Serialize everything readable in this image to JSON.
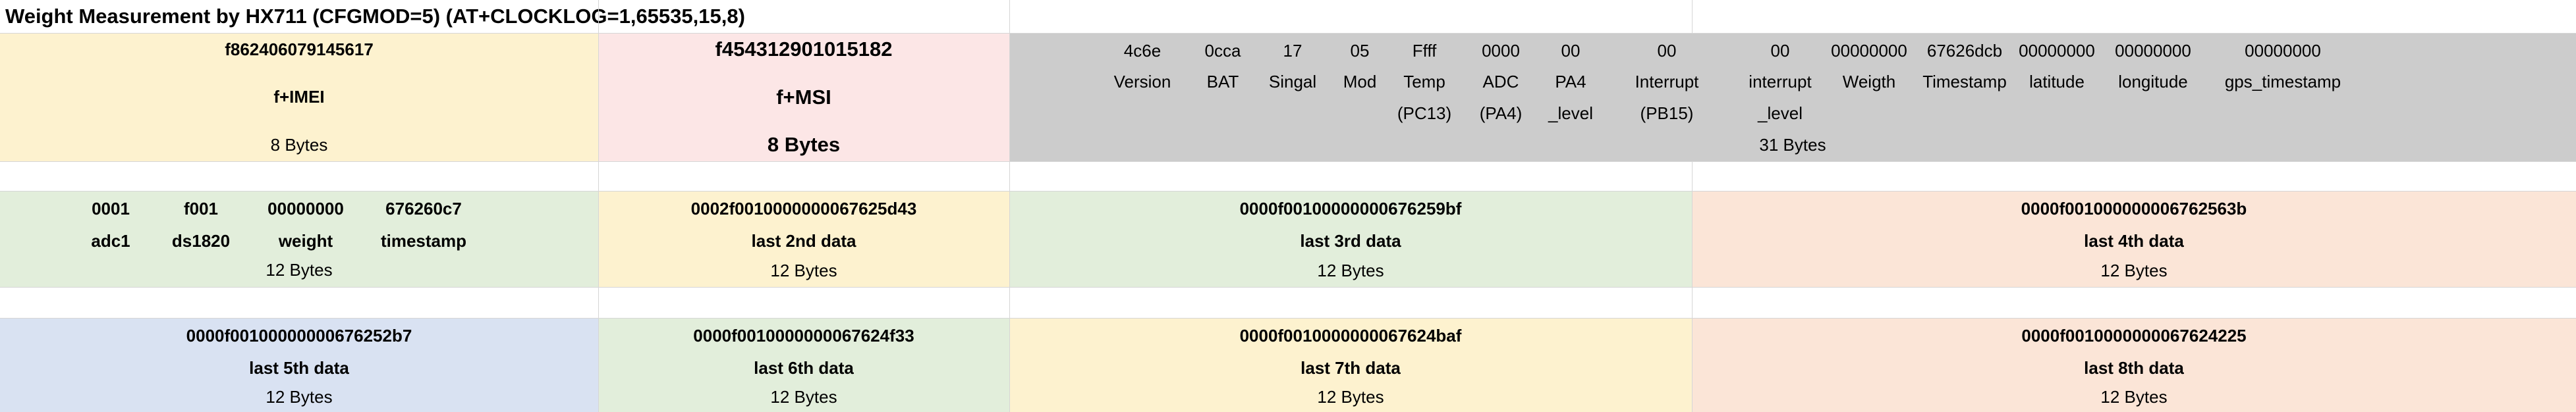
{
  "title": "Weight Measurement by HX711  (CFGMOD=5)  (AT+CLOCKLOG=1,65535,15,8)",
  "header": {
    "imei_value": "f862406079145617",
    "imei_label": "f+IMEI",
    "imei_size": "8 Bytes",
    "imsi_value": "f454312901015182",
    "imsi_label": "f+MSI",
    "imsi_size": "8 Bytes",
    "payload_size": "31 Bytes",
    "fields": [
      {
        "value": "4c6e",
        "label": "Version",
        "label2": ""
      },
      {
        "value": "0cca",
        "label": "BAT",
        "label2": ""
      },
      {
        "value": "17",
        "label": "Singal",
        "label2": ""
      },
      {
        "value": "05",
        "label": "Mod",
        "label2": ""
      },
      {
        "value": "Ffff",
        "label": "Temp",
        "label2": "(PC13)"
      },
      {
        "value": "0000",
        "label": "ADC",
        "label2": "(PA4)"
      },
      {
        "value": "00",
        "label": "PA4",
        "label2": "_level"
      },
      {
        "value": "00",
        "label": "Interrupt",
        "label2": "(PB15)"
      },
      {
        "value": "00",
        "label": "interrupt",
        "label2": "_level"
      },
      {
        "value": "00000000",
        "label": "Weigth",
        "label2": ""
      },
      {
        "value": "67626dcb",
        "label": "Timestamp",
        "label2": ""
      },
      {
        "value": "00000000",
        "label": "latitude",
        "label2": ""
      },
      {
        "value": "00000000",
        "label": "longitude",
        "label2": ""
      },
      {
        "value": "00000000",
        "label": "gps_timestamp",
        "label2": ""
      }
    ]
  },
  "row2": {
    "first": {
      "values": [
        "0001",
        "f001",
        "00000000",
        "676260c7"
      ],
      "labels": [
        "adc1",
        "ds1820",
        "weight",
        "timestamp"
      ],
      "size": "12 Bytes"
    },
    "blocks": [
      {
        "value": "0002f0010000000067625d43",
        "label": "last 2nd data",
        "size": "12 Bytes"
      },
      {
        "value": "0000f00100000000676259bf",
        "label": "last 3rd data",
        "size": "12 Bytes"
      },
      {
        "value": "0000f0010000000067625 63b",
        "label": "last 4th data",
        "size": "12 Bytes"
      }
    ]
  },
  "row3": {
    "blocks": [
      {
        "value": "0000f00100000000676252b7",
        "label": "last 5th data",
        "size": "12 Bytes"
      },
      {
        "value": "0000f0010000000067624f33",
        "label": "last 6th data",
        "size": "12 Bytes"
      },
      {
        "value": "0000f0010000000067624baf",
        "label": "last 7th data",
        "size": "12 Bytes"
      },
      {
        "value": "0000f00100000000676242 25",
        "label": "last 8th data",
        "size": "12 Bytes"
      }
    ]
  },
  "colors": {
    "yellow": "#fdf2cf",
    "pink": "#fce6e6",
    "gray": "#cccccc",
    "green": "#e2eedb",
    "orange": "#fbe5d7",
    "blue": "#d9e2f2"
  }
}
